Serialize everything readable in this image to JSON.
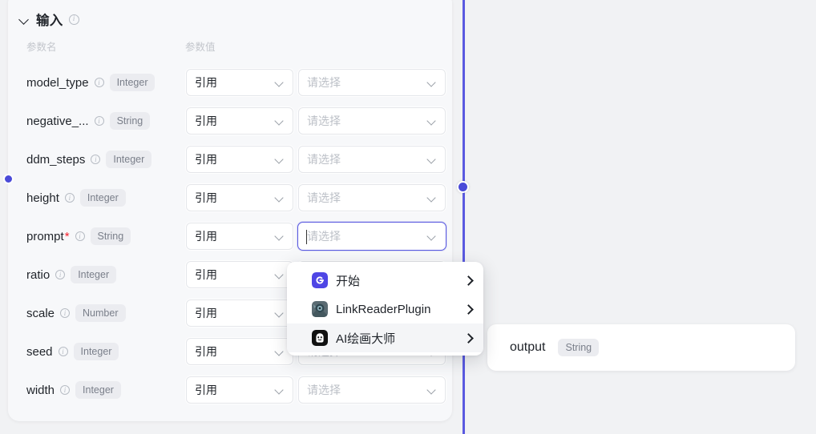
{
  "card": {
    "title": "输入",
    "collapse_icon": "chevron-down-icon",
    "info_icon": "info-circle-icon",
    "col_param_name": "参数名",
    "col_param_value": "参数值"
  },
  "params": [
    {
      "name": "model_type",
      "required": false,
      "type": "Integer",
      "ref": "引用",
      "value_placeholder": "请选择",
      "focused": false
    },
    {
      "name": "negative_...",
      "required": false,
      "type": "String",
      "ref": "引用",
      "value_placeholder": "请选择",
      "focused": false
    },
    {
      "name": "ddm_steps",
      "required": false,
      "type": "Integer",
      "ref": "引用",
      "value_placeholder": "请选择",
      "focused": false
    },
    {
      "name": "height",
      "required": false,
      "type": "Integer",
      "ref": "引用",
      "value_placeholder": "请选择",
      "focused": false
    },
    {
      "name": "prompt",
      "required": true,
      "type": "String",
      "ref": "引用",
      "value_placeholder": "请选择",
      "focused": true
    },
    {
      "name": "ratio",
      "required": false,
      "type": "Integer",
      "ref": "引用",
      "value_placeholder": "请选择",
      "focused": false
    },
    {
      "name": "scale",
      "required": false,
      "type": "Number",
      "ref": "引用",
      "value_placeholder": "请选择",
      "focused": false
    },
    {
      "name": "seed",
      "required": false,
      "type": "Integer",
      "ref": "引用",
      "value_placeholder": "请选择",
      "focused": false
    },
    {
      "name": "width",
      "required": false,
      "type": "Integer",
      "ref": "引用",
      "value_placeholder": "请选择",
      "focused": false
    }
  ],
  "dropdown": {
    "items": [
      {
        "label": "开始",
        "icon": "start-node-icon",
        "submenu_icon": "chevron-right-icon",
        "hovered": false
      },
      {
        "label": "LinkReaderPlugin",
        "icon": "link-reader-plugin-icon",
        "submenu_icon": "chevron-right-icon",
        "hovered": false
      },
      {
        "label": "AI绘画大师",
        "icon": "ai-painting-master-icon",
        "submenu_icon": "chevron-right-icon",
        "hovered": true
      }
    ]
  },
  "output": {
    "name": "output",
    "type": "String"
  },
  "colors": {
    "accent": "#5a5ae0",
    "node_dot": "#4a4ad8",
    "required_star": "#f5222d",
    "canvas_bg": "#f1f2f4",
    "card_bg": "#f7f8fa",
    "chip_bg": "#ebecf0"
  }
}
